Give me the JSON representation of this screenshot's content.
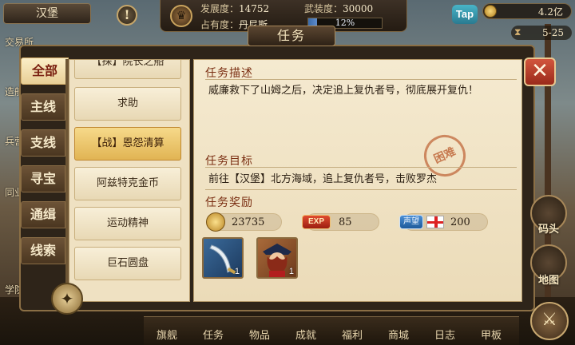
{
  "topbar": {
    "city": "汉堡",
    "development_label": "发展度：",
    "development_value": "14752",
    "armament_label": "武装度：",
    "armament_value": "30000",
    "occupation_label": "占有度：",
    "occupation_owner": "丹尼斯",
    "occupation_percent": 0.12,
    "occupation_text": "12%",
    "tap_label": "Tap",
    "gold": "4.2亿",
    "date": "5-25"
  },
  "side_labels": [
    "交易所",
    "造船厂",
    "兵营",
    "同业会",
    "学院"
  ],
  "window": {
    "title": "任务",
    "close_label": "✕"
  },
  "categories": [
    {
      "label": "全部",
      "active": true
    },
    {
      "label": "主线",
      "active": false
    },
    {
      "label": "支线",
      "active": false
    },
    {
      "label": "寻宝",
      "active": false
    },
    {
      "label": "通缉",
      "active": false
    },
    {
      "label": "线索",
      "active": false
    }
  ],
  "quests": [
    {
      "label": "【探】院长之船",
      "active": false
    },
    {
      "label": "求助",
      "active": false
    },
    {
      "label": "【战】恩怨清算",
      "active": true
    },
    {
      "label": "阿兹特克金币",
      "active": false
    },
    {
      "label": "运动精神",
      "active": false
    },
    {
      "label": "巨石圆盘",
      "active": false
    }
  ],
  "detail": {
    "desc_title": "任务描述",
    "desc_text": "威廉救下了山姆之后，决定追上复仇者号，彻底展开复仇！",
    "goal_title": "任务目标",
    "goal_text": "前往【汉堡】北方海域，追上复仇者号，击败罗杰",
    "difficulty_stamp": "困难",
    "reward_title": "任务奖励",
    "rewards": {
      "gold": "23735",
      "exp_label": "EXP",
      "exp": "85",
      "reputation_label": "声望",
      "reputation": "200"
    },
    "items": [
      {
        "name": "sword",
        "count": "1"
      },
      {
        "name": "hero-portrait",
        "count": "1"
      }
    ]
  },
  "right_buttons": [
    "码头",
    "地图"
  ],
  "bottom_nav": [
    "旗舰",
    "任务",
    "物品",
    "成就",
    "福利",
    "商城",
    "日志",
    "甲板"
  ],
  "colors": {
    "accent_red": "#7a2e12",
    "panel_bg": "#f5ead0",
    "active_quest": "#e1b453"
  }
}
